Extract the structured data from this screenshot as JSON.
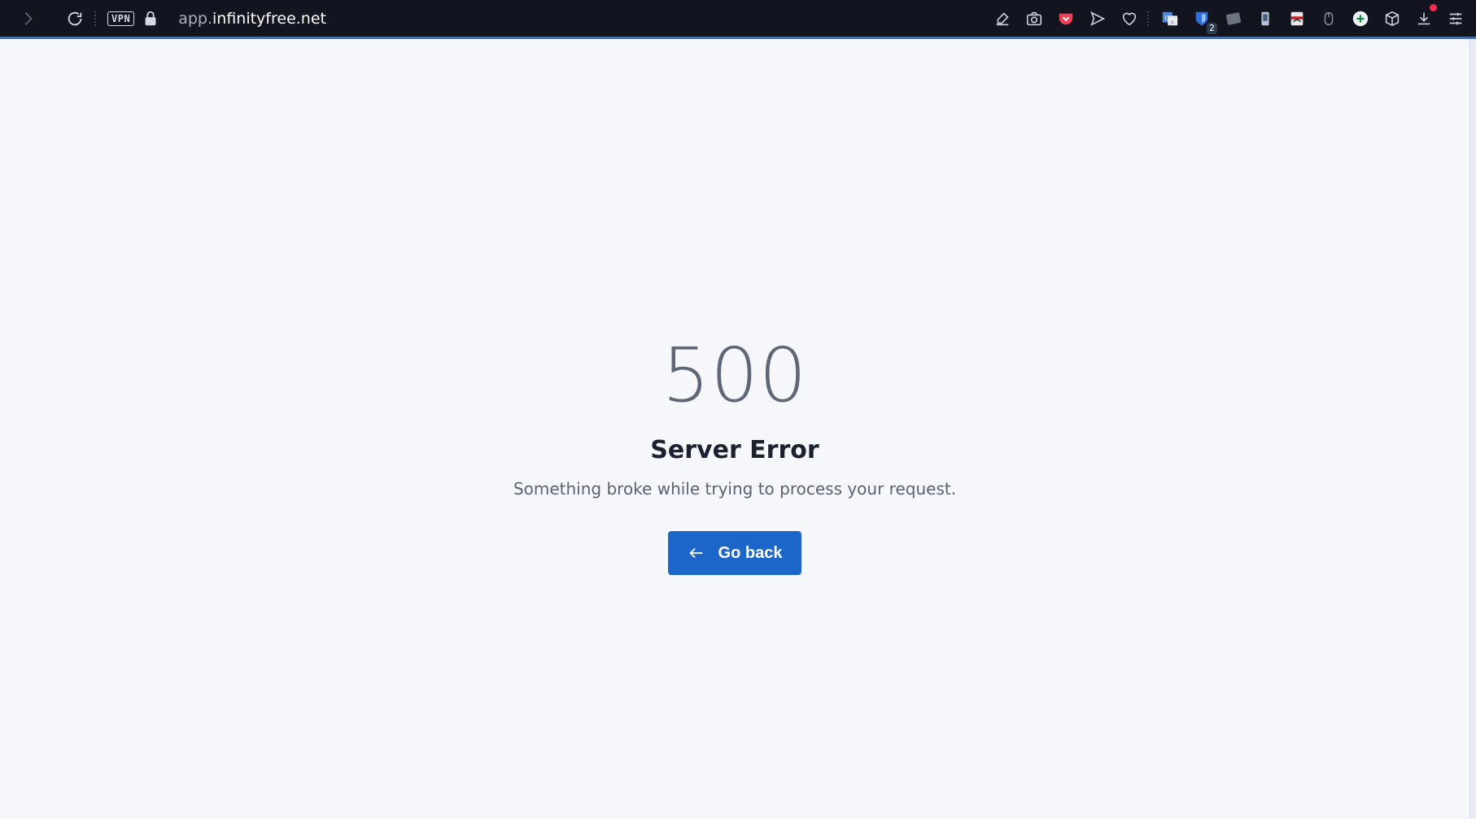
{
  "browser": {
    "vpn_label": "VPN",
    "url_prefix": "app.",
    "url_domain": "infinityfree.net",
    "extensions": [
      {
        "name": "edit-icon"
      },
      {
        "name": "camera-icon"
      },
      {
        "name": "pocket-icon"
      },
      {
        "name": "send-icon"
      },
      {
        "name": "heart-icon"
      },
      {
        "name": "translate-icon"
      },
      {
        "name": "bitwarden-icon",
        "badge": "2"
      },
      {
        "name": "ext-gray-icon"
      },
      {
        "name": "phone-icon"
      },
      {
        "name": "ext-mask-icon"
      },
      {
        "name": "mouse-icon"
      },
      {
        "name": "add-circle-icon"
      },
      {
        "name": "box-icon"
      },
      {
        "name": "download-icon"
      },
      {
        "name": "menu-icon"
      }
    ]
  },
  "error": {
    "code": "500",
    "title": "Server Error",
    "message": "Something broke while trying to process your request.",
    "button_label": "Go back"
  },
  "colors": {
    "toolbar_bg": "#12151f",
    "accent": "#2b74d6",
    "button": "#1c66c9",
    "page_bg": "#f5f7fb"
  }
}
